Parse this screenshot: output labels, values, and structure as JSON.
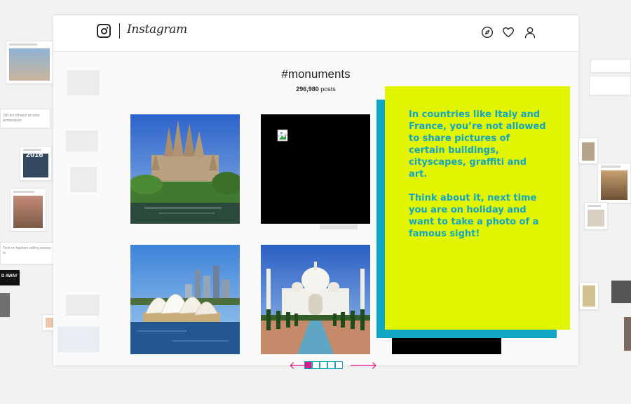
{
  "app": {
    "brand": "Instagram"
  },
  "nav": {
    "icons": [
      "compass-icon",
      "heart-icon",
      "profile-icon"
    ]
  },
  "page": {
    "hashtag": "#monuments",
    "post_count": "296,980",
    "post_count_suffix": "posts"
  },
  "grid": [
    {
      "name": "sagrada-familia-photo",
      "subject": "Sagrada Familia"
    },
    {
      "name": "broken-image-post",
      "subject": "broken image"
    },
    {
      "name": "sydney-opera-house-photo",
      "subject": "Sydney Opera House"
    },
    {
      "name": "taj-mahal-photo",
      "subject": "Taj Mahal"
    }
  ],
  "info_card": {
    "paragraph1": "In countries like Italy and France, you’re not allowed to share pictures of certain buildings, cityscapes, graffiti and art.",
    "paragraph2": "Think about it, next time you are on holiday and want to take a photo of a famous sight!"
  },
  "pager": {
    "prev": "🡐",
    "next": "🡒",
    "pages": 5,
    "current": 1
  },
  "background": {
    "year_badge": "2016",
    "tweet_snippet": "200 km ethanol at room temperature",
    "news_snippet": "Tech on hackers selling access to",
    "poster_text": "D AWAY"
  },
  "colors": {
    "accent_yellow": "#e2f500",
    "accent_cyan": "#12a6c6",
    "accent_magenta": "#e0158c"
  }
}
